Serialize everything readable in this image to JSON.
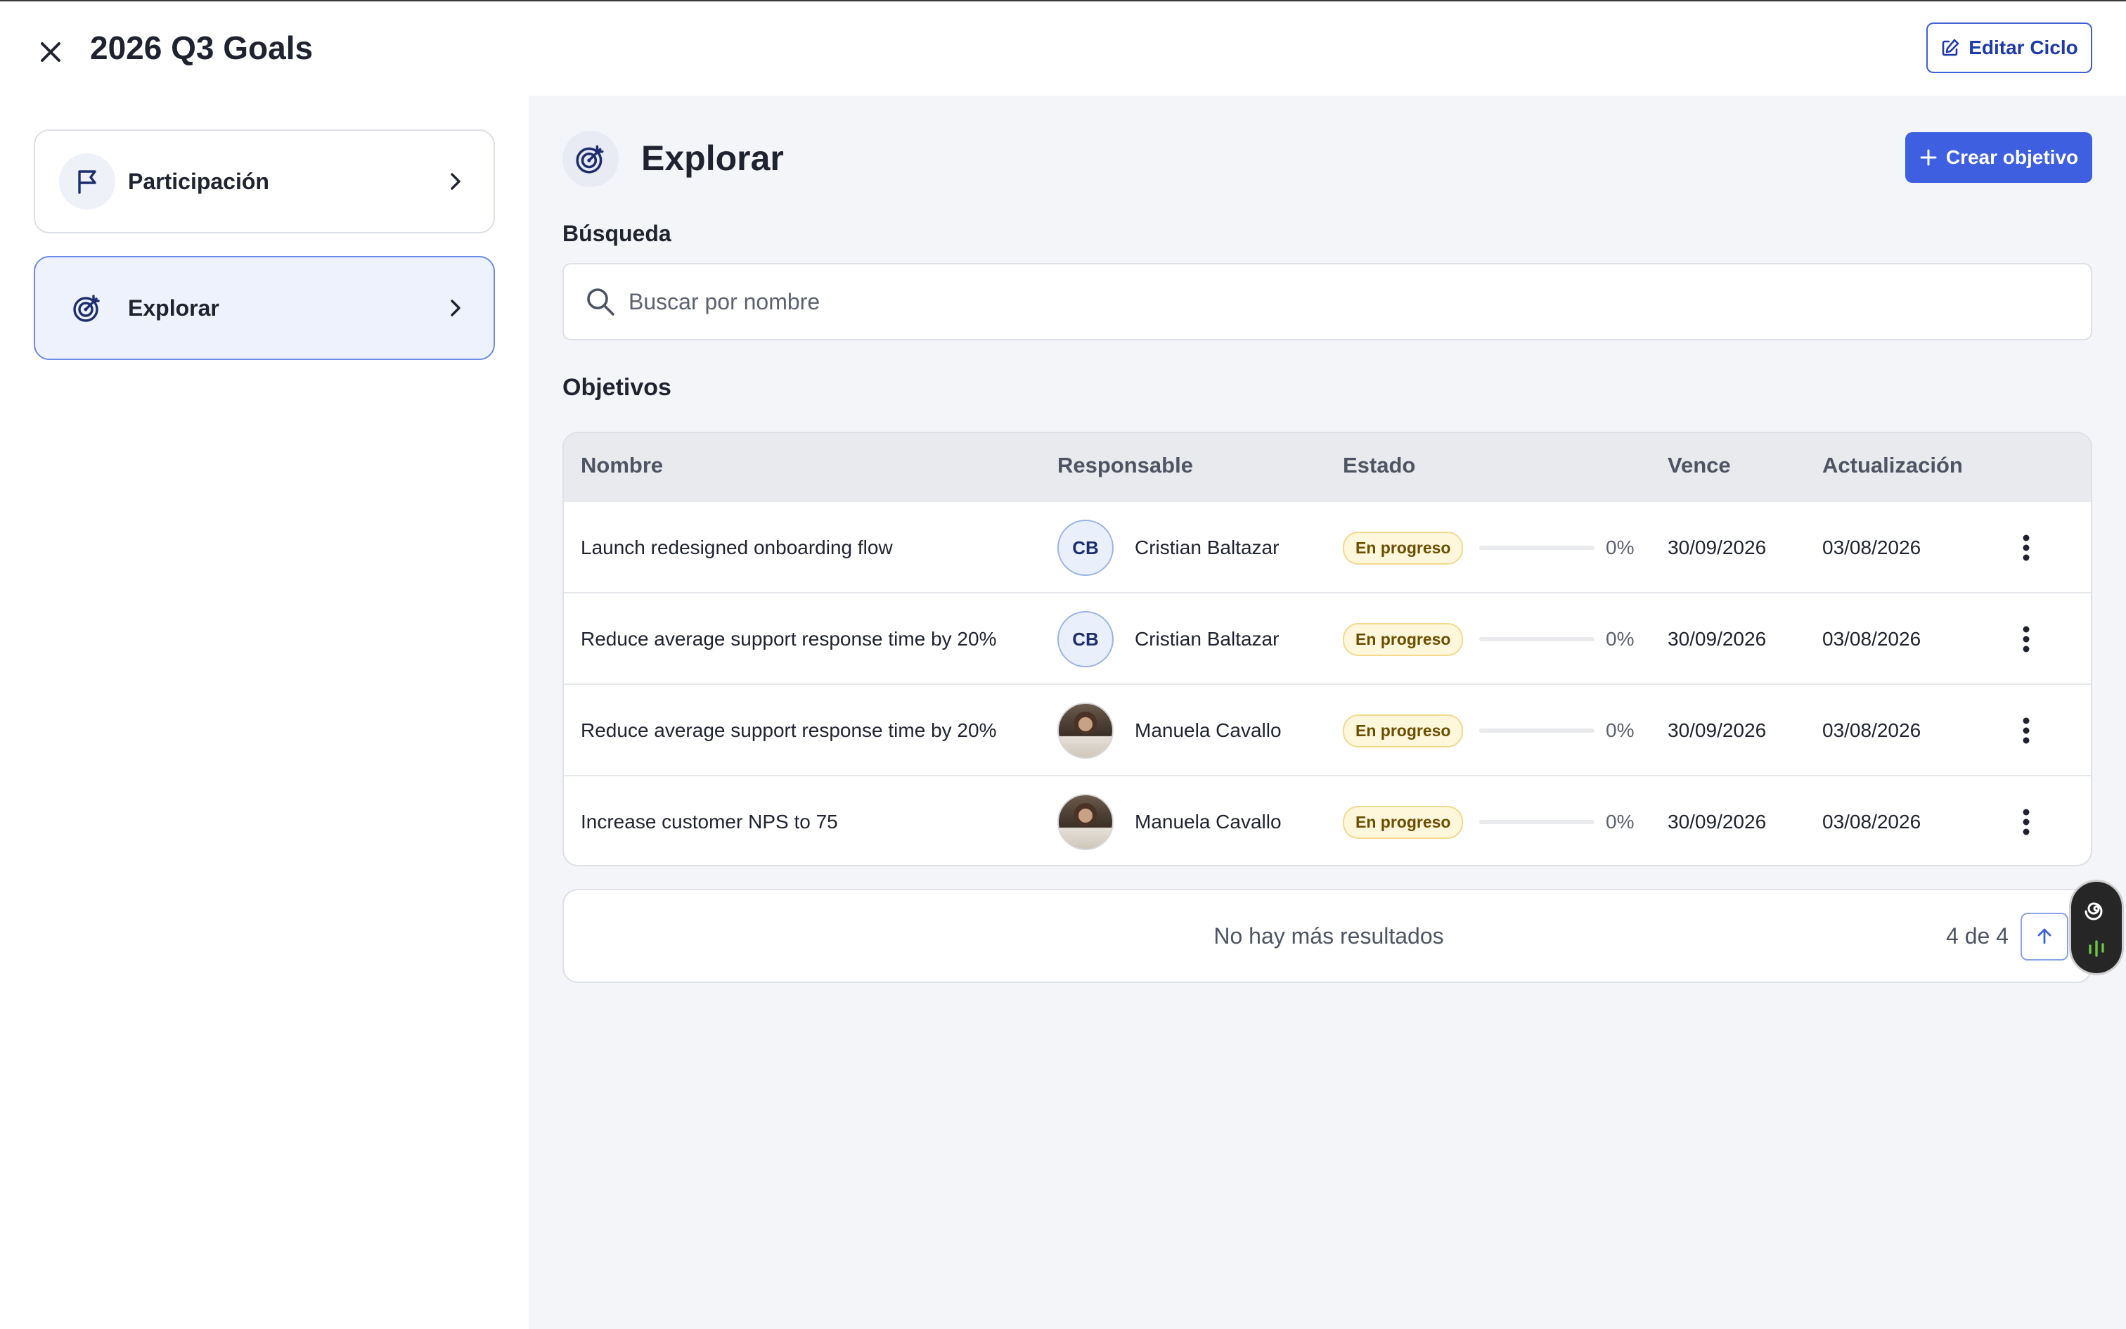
{
  "header": {
    "title": "2026 Q3 Goals",
    "edit_label": "Editar Ciclo"
  },
  "sidebar": {
    "items": [
      {
        "label": "Participación",
        "icon": "flag-icon",
        "active": false
      },
      {
        "label": "Explorar",
        "icon": "target-icon",
        "active": true
      }
    ]
  },
  "main": {
    "title": "Explorar",
    "create_label": "Crear objetivo",
    "search_label": "Búsqueda",
    "search_placeholder": "Buscar por nombre",
    "objectives_label": "Objetivos"
  },
  "table": {
    "columns": [
      "Nombre",
      "Responsable",
      "Estado",
      "Vence",
      "Actualización"
    ],
    "rows": [
      {
        "name": "Launch redesigned onboarding flow",
        "owner_initials": "CB",
        "owner": "Cristian Baltazar",
        "status": "En progreso",
        "progress": 0,
        "progress_label": "0%",
        "due": "30/09/2026",
        "updated": "03/08/2026"
      },
      {
        "name": "Reduce average support response time by 20%",
        "owner_initials": "CB",
        "owner": "Cristian Baltazar",
        "status": "En progreso",
        "progress": 0,
        "progress_label": "0%",
        "due": "30/09/2026",
        "updated": "03/08/2026"
      },
      {
        "name": "Reduce average support response time by 20%",
        "owner_initials": "",
        "owner": "Manuela Cavallo",
        "status": "En progreso",
        "progress": 0,
        "progress_label": "0%",
        "due": "30/09/2026",
        "updated": "03/08/2026"
      },
      {
        "name": "Increase customer NPS to 75",
        "owner_initials": "",
        "owner": "Manuela Cavallo",
        "status": "En progreso",
        "progress": 0,
        "progress_label": "0%",
        "due": "30/09/2026",
        "updated": "03/08/2026"
      }
    ]
  },
  "footer": {
    "no_more_label": "No hay más resultados",
    "count_label": "4 de 4"
  },
  "colors": {
    "accent": "#3d5fe0",
    "badge_bg": "#fff7dc",
    "badge_text": "#6b4e00",
    "active_card_bg": "#edf2fd"
  }
}
